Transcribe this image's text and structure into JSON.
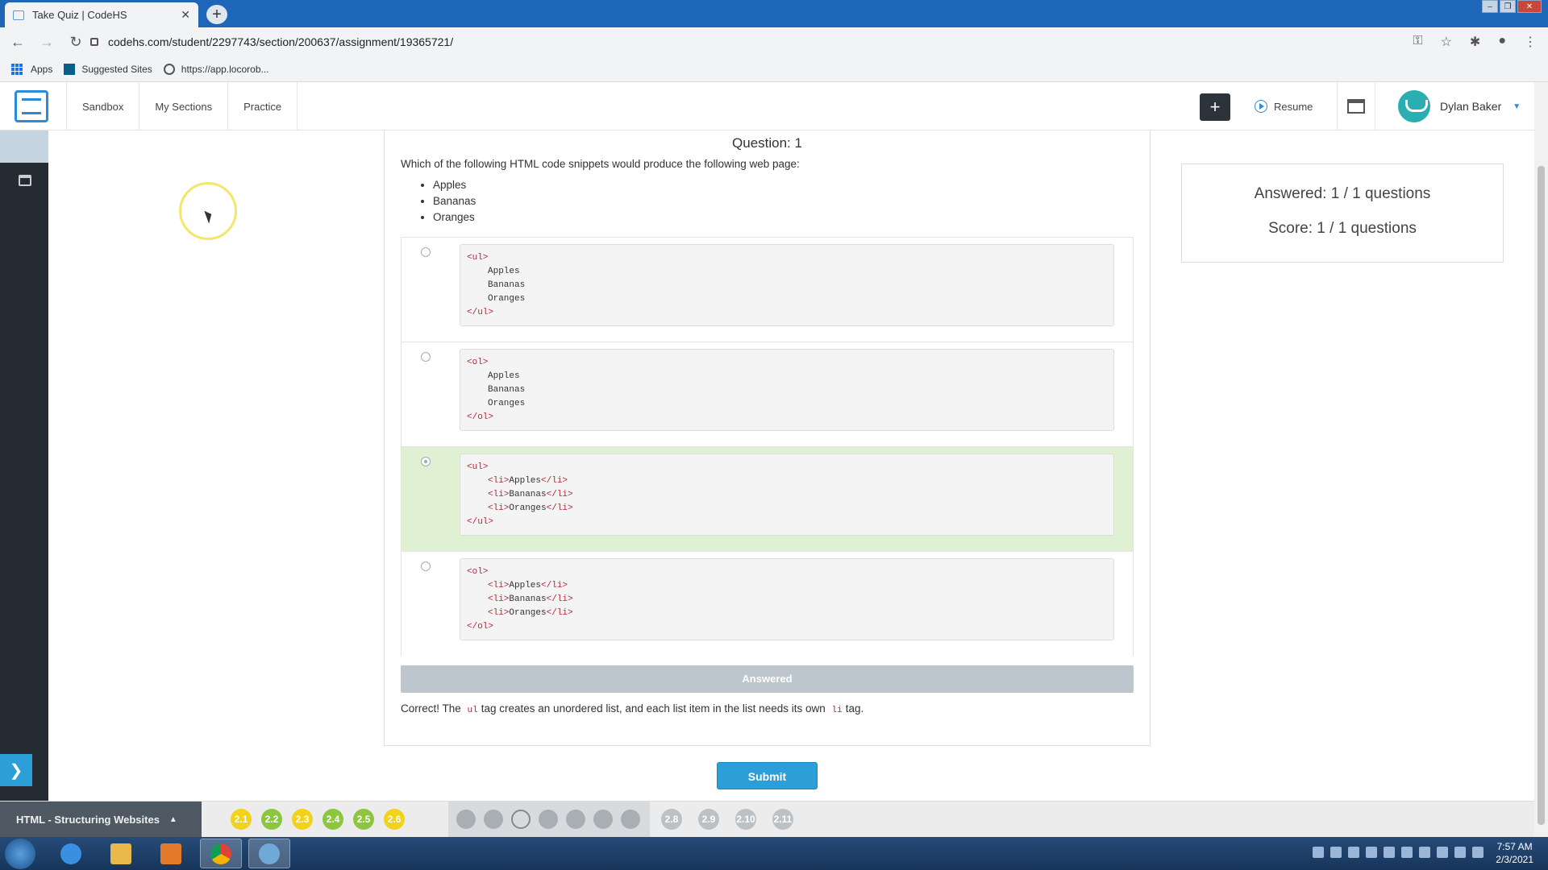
{
  "browser": {
    "tab_title": "Take Quiz | CodeHS",
    "url": "codehs.com/student/2297743/section/200637/assignment/19365721/",
    "bookmarks": [
      {
        "label": "Apps",
        "icon": "apps-grid-icon"
      },
      {
        "label": "Suggested Sites",
        "icon": "bing-icon"
      },
      {
        "label": "https://app.locorob...",
        "icon": "globe-icon"
      }
    ]
  },
  "header": {
    "nav": [
      "Sandbox",
      "My Sections",
      "Practice"
    ],
    "resume_label": "Resume",
    "user_name": "Dylan Baker"
  },
  "quiz": {
    "title": "Question: 1",
    "question": "Which of the following HTML code snippets would produce the following web page:",
    "list_items": [
      "Apples",
      "Bananas",
      "Oranges"
    ],
    "options": [
      {
        "selected": false,
        "correct": false,
        "lines": [
          {
            "indent": 0,
            "open": "<ul>",
            "text": "",
            "close": ""
          },
          {
            "indent": 1,
            "open": "",
            "text": "Apples",
            "close": ""
          },
          {
            "indent": 1,
            "open": "",
            "text": "Bananas",
            "close": ""
          },
          {
            "indent": 1,
            "open": "",
            "text": "Oranges",
            "close": ""
          },
          {
            "indent": 0,
            "open": "</ul>",
            "text": "",
            "close": ""
          }
        ]
      },
      {
        "selected": false,
        "correct": false,
        "lines": [
          {
            "indent": 0,
            "open": "<ol>",
            "text": "",
            "close": ""
          },
          {
            "indent": 1,
            "open": "",
            "text": "Apples",
            "close": ""
          },
          {
            "indent": 1,
            "open": "",
            "text": "Bananas",
            "close": ""
          },
          {
            "indent": 1,
            "open": "",
            "text": "Oranges",
            "close": ""
          },
          {
            "indent": 0,
            "open": "</ol>",
            "text": "",
            "close": ""
          }
        ]
      },
      {
        "selected": true,
        "correct": true,
        "lines": [
          {
            "indent": 0,
            "open": "<ul>",
            "text": "",
            "close": ""
          },
          {
            "indent": 1,
            "open": "<li>",
            "text": "Apples",
            "close": "</li>"
          },
          {
            "indent": 1,
            "open": "<li>",
            "text": "Bananas",
            "close": "</li>"
          },
          {
            "indent": 1,
            "open": "<li>",
            "text": "Oranges",
            "close": "</li>"
          },
          {
            "indent": 0,
            "open": "</ul>",
            "text": "",
            "close": ""
          }
        ]
      },
      {
        "selected": false,
        "correct": false,
        "lines": [
          {
            "indent": 0,
            "open": "<ol>",
            "text": "",
            "close": ""
          },
          {
            "indent": 1,
            "open": "<li>",
            "text": "Apples",
            "close": "</li>"
          },
          {
            "indent": 1,
            "open": "<li>",
            "text": "Bananas",
            "close": "</li>"
          },
          {
            "indent": 1,
            "open": "<li>",
            "text": "Oranges",
            "close": "</li>"
          },
          {
            "indent": 0,
            "open": "</ol>",
            "text": "",
            "close": ""
          }
        ]
      }
    ],
    "answered_label": "Answered",
    "feedback": {
      "prefix": "Correct! The",
      "code1": "ul",
      "middle": "tag creates an unordered list, and each list item in the list needs its own",
      "code2": "li",
      "suffix": "tag."
    },
    "submit_label": "Submit"
  },
  "score": {
    "answered": "Answered:  1 / 1 questions",
    "score": "Score: 1 / 1 questions"
  },
  "progress": {
    "unit_title": "HTML - Structuring Websites",
    "lessons_done": [
      {
        "label": "2.1",
        "color": "yellow"
      },
      {
        "label": "2.2",
        "color": "green"
      },
      {
        "label": "2.3",
        "color": "yellow"
      },
      {
        "label": "2.4",
        "color": "green"
      },
      {
        "label": "2.5",
        "color": "green"
      },
      {
        "label": "2.6",
        "color": "yellow"
      }
    ],
    "lessons_rest": [
      "2.8",
      "2.9",
      "2.10",
      "2.11"
    ]
  },
  "taskbar": {
    "time": "7:57 AM",
    "date": "2/3/2021"
  },
  "colors": {
    "accent": "#2c9fd8",
    "correct_bg": "#dff0d3",
    "code_tag": "#b0283a"
  }
}
